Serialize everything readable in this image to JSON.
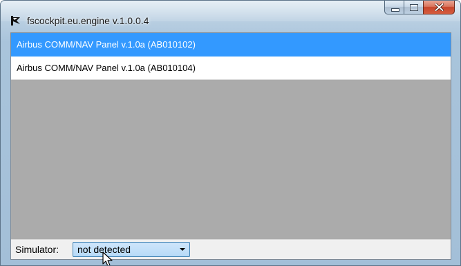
{
  "window": {
    "title": "fscockpit.eu.engine v.1.0.0.4",
    "icon": "aircraft-icon"
  },
  "caption_buttons": {
    "minimize": "minimize-icon",
    "maximize": "maximize-icon",
    "close": "close-icon"
  },
  "panels": [
    {
      "label": "Airbus COMM/NAV Panel v.1.0a (AB010102)",
      "selected": true
    },
    {
      "label": "Airbus COMM/NAV Panel v.1.0a (AB010104)",
      "selected": false
    }
  ],
  "status": {
    "simulator_label": "Simulator:",
    "simulator_value": "not detected"
  },
  "colors": {
    "selection": "#3399ff",
    "list_background": "#ababab",
    "close_button": "#c7452b",
    "select_highlight": "#b7daf7"
  }
}
